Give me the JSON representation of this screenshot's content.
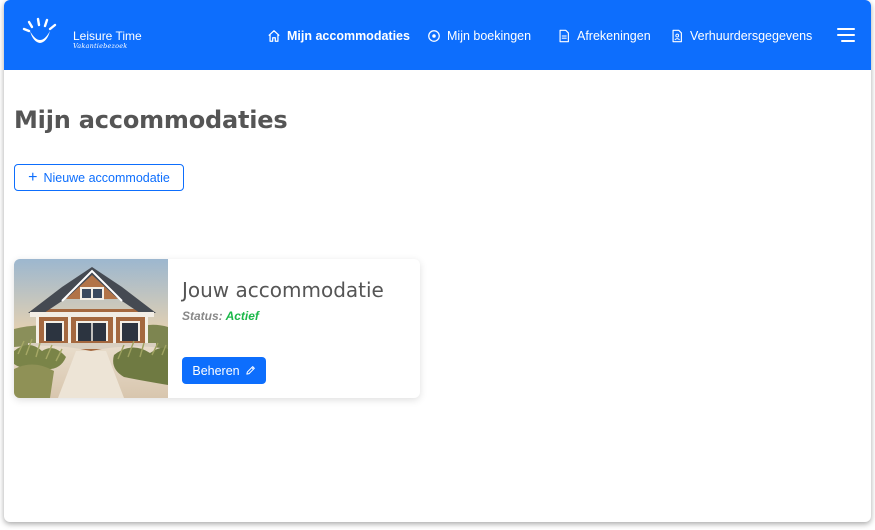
{
  "brand": {
    "name": "Leisure Time",
    "subtitle": "Vakantiebezoek"
  },
  "nav": {
    "items": [
      {
        "label": "Mijn accommodaties",
        "icon": "home-icon",
        "active": true
      },
      {
        "label": "Mijn boekingen",
        "icon": "circle-dot-icon",
        "active": false
      },
      {
        "label": "Afrekeningen",
        "icon": "document-icon",
        "active": false
      },
      {
        "label": "Verhuurdersgegevens",
        "icon": "person-document-icon",
        "active": false
      }
    ],
    "menu_icon": "hamburger-menu-icon"
  },
  "main": {
    "title": "Mijn accommodaties",
    "new_button": {
      "icon": "plus-icon",
      "label": "Nieuwe accommodatie"
    }
  },
  "accommodation": {
    "title": "Jouw accommodatie",
    "status_label": "Status:",
    "status_value": "Actief",
    "manage_button": {
      "label": "Beheren",
      "icon": "pencil-icon"
    }
  },
  "colors": {
    "primary": "#0d6efd",
    "status_active": "#1cb84a",
    "title_text": "#555555"
  }
}
